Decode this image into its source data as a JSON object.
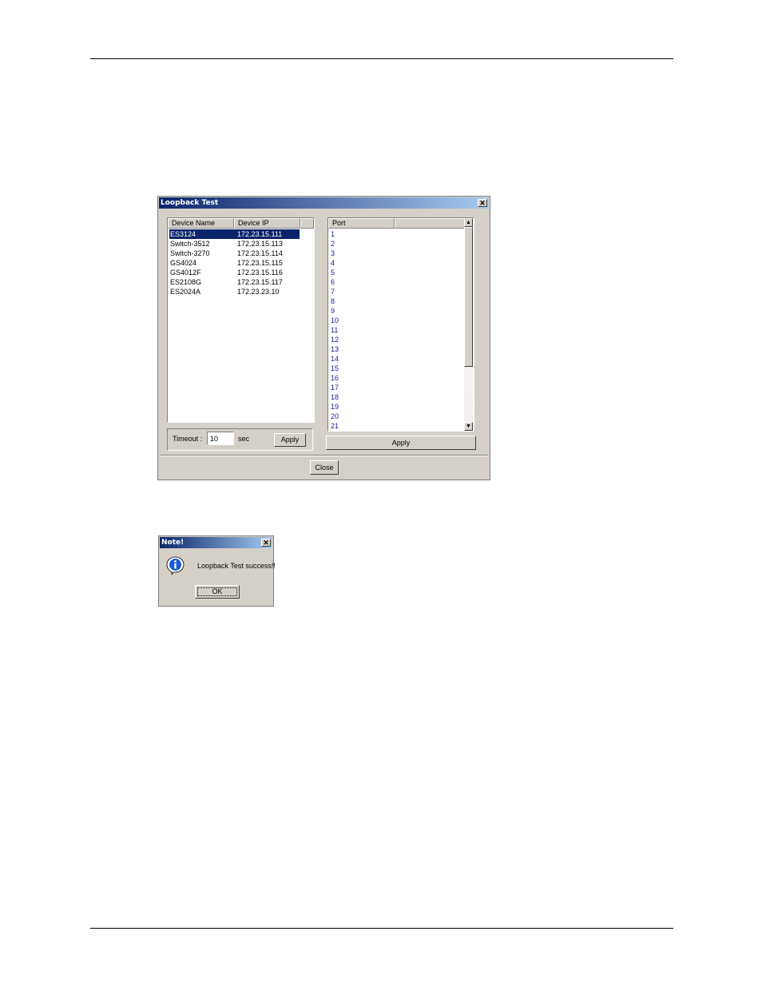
{
  "loopback_dialog": {
    "title": "Loopback Test",
    "close_glyph": "✕",
    "devices": {
      "columns": [
        "Device Name",
        "Device IP"
      ],
      "rows": [
        {
          "name": "ES3124",
          "ip": "172.23.15.111",
          "selected": true
        },
        {
          "name": "Switch-3512",
          "ip": "172.23.15.113",
          "selected": false
        },
        {
          "name": "Switch-3270",
          "ip": "172.23.15.114",
          "selected": false
        },
        {
          "name": "GS4024",
          "ip": "172.23.15.115",
          "selected": false
        },
        {
          "name": "GS4012F",
          "ip": "172.23.15.116",
          "selected": false
        },
        {
          "name": "ES2108G",
          "ip": "172.23.15.117",
          "selected": false
        },
        {
          "name": "ES2024A",
          "ip": "172.23.23.10",
          "selected": false
        }
      ]
    },
    "ports": {
      "column": "Port",
      "items": [
        "1",
        "2",
        "3",
        "4",
        "5",
        "6",
        "7",
        "8",
        "9",
        "10",
        "11",
        "12",
        "13",
        "14",
        "15",
        "16",
        "17",
        "18",
        "19",
        "20",
        "21"
      ]
    },
    "timeout_label": "Timeout :",
    "timeout_value": "10",
    "timeout_unit": "sec",
    "apply_left_label": "Apply",
    "apply_right_label": "Apply",
    "close_label": "Close"
  },
  "note_dialog": {
    "title": "Note!",
    "close_glyph": "✕",
    "message": "Loopback Test success!!",
    "ok_label": "OK",
    "icon": "info-icon"
  },
  "colors": {
    "selection": "#0a246a",
    "dialog_face": "#d4d0c8",
    "port_text": "#1a1a9a"
  }
}
